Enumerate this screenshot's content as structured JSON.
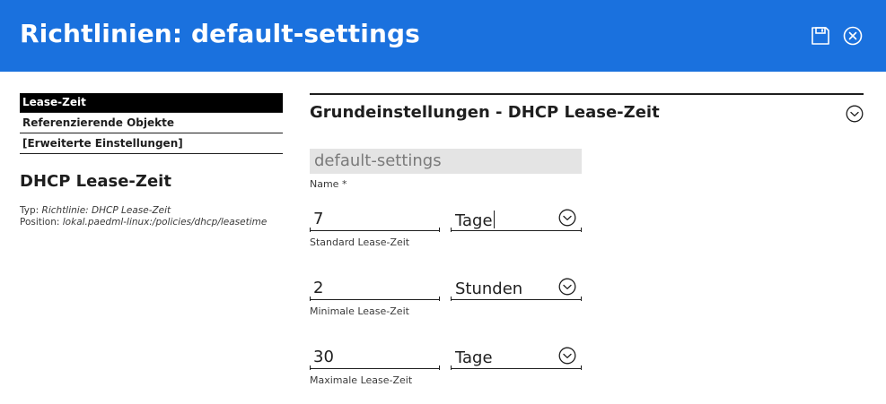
{
  "header": {
    "title": "Richtlinien: default-settings",
    "icons": {
      "save": "floppy-disk-icon",
      "close": "circle-x-icon"
    },
    "colors": {
      "background": "#1a71de",
      "text": "#ffffff"
    }
  },
  "sidebar": {
    "nav": [
      {
        "label": "Lease-Zeit",
        "active": true
      },
      {
        "label": "Referenzierende Objekte",
        "active": false
      },
      {
        "label": "[Erweiterte Einstellungen]",
        "active": false
      }
    ],
    "title": "DHCP Lease-Zeit",
    "type_label": "Typ: ",
    "type_value": "Richtlinie: DHCP Lease-Zeit",
    "position_label": "Position: ",
    "position_value": "lokal.paedml-linux:/policies/dhcp/leasetime"
  },
  "section": {
    "title": "Grundeinstellungen - DHCP Lease-Zeit",
    "toggle_icon": "chevron-down-circle-icon"
  },
  "form": {
    "name": {
      "value": "default-settings",
      "label": "Name *"
    },
    "standard": {
      "value": "7",
      "unit": "Tage",
      "label": "Standard Lease-Zeit"
    },
    "minimal": {
      "value": "2",
      "unit": "Stunden",
      "label": "Minimale Lease-Zeit"
    },
    "maximal": {
      "value": "30",
      "unit": "Tage",
      "label": "Maximale Lease-Zeit"
    }
  }
}
